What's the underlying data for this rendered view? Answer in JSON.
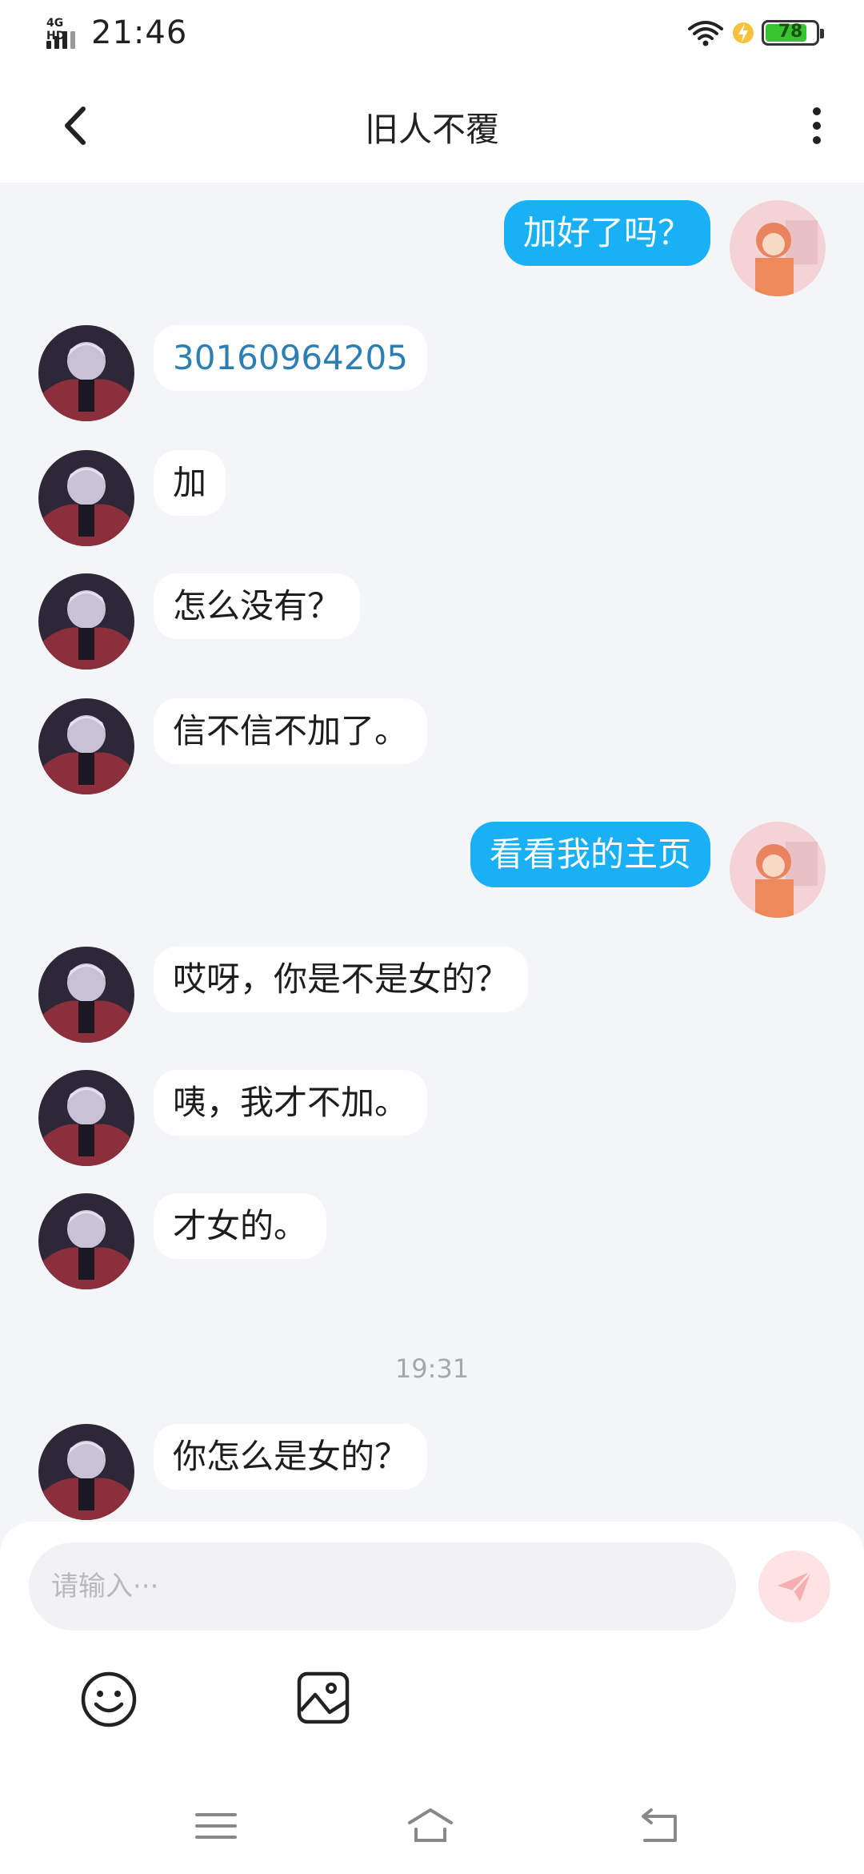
{
  "status_bar": {
    "network": "4G HD",
    "time": "21:46",
    "battery": "78",
    "battery_level": 0.78
  },
  "header": {
    "title": "旧人不覆"
  },
  "messages": [
    {
      "side": "right",
      "text": "加好了吗？"
    },
    {
      "side": "left",
      "text": "30160964205",
      "is_link": true
    },
    {
      "side": "left",
      "text": "加"
    },
    {
      "side": "left",
      "text": "怎么没有？"
    },
    {
      "side": "left",
      "text": "信不信不加了。"
    },
    {
      "side": "right",
      "text": "看看我的主页"
    },
    {
      "side": "left",
      "text": "哎呀，你是不是女的？"
    },
    {
      "side": "left",
      "text": "咦，我才不加。"
    },
    {
      "side": "left",
      "text": "才女的。"
    },
    {
      "side": "left",
      "text": "你怎么是女的？"
    }
  ],
  "timestamp": "19:31",
  "input": {
    "placeholder": "请输入···",
    "value": ""
  },
  "colors": {
    "outgoing_bubble": "#1ab0f5",
    "incoming_bubble": "#ffffff",
    "link_text": "#2d7fb3",
    "send_button": "#fde3e3",
    "background": "#f4f5f7"
  },
  "icons": [
    "back-arrow-icon",
    "more-vertical-icon",
    "send-icon",
    "emoji-icon",
    "image-icon",
    "menu-icon",
    "home-icon",
    "back-icon"
  ]
}
